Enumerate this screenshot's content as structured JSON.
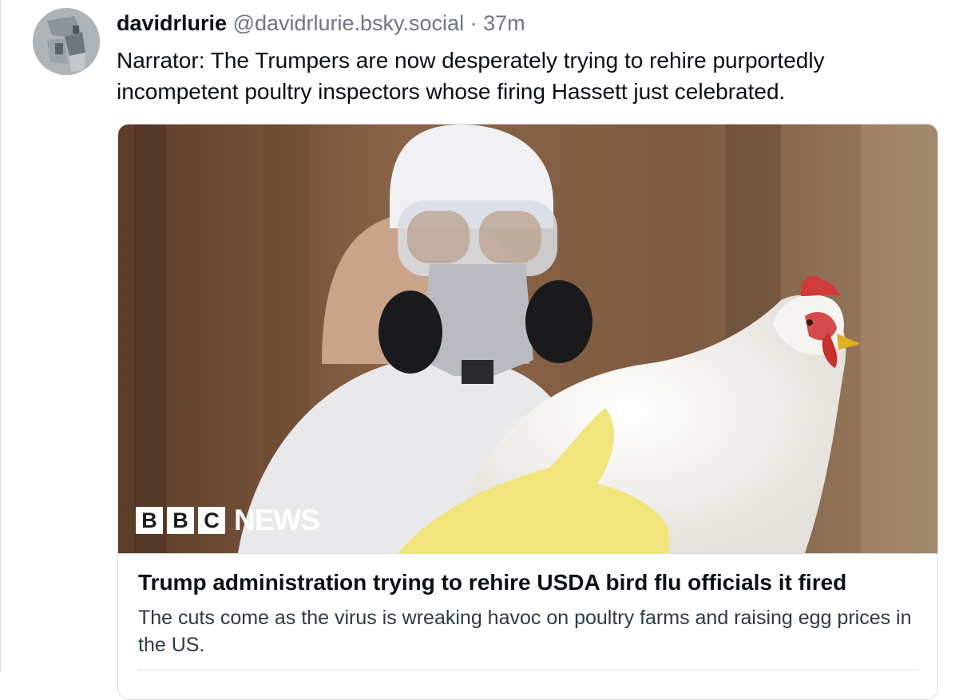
{
  "post": {
    "display_name": "davidrlurie",
    "handle": "@davidrlurie.bsky.social",
    "separator": "·",
    "time": "37m",
    "text": "Narrator: The Trumpers are now desperately trying to rehire purportedly incompetent poultry inspectors whose firing Hassett just celebrated."
  },
  "card": {
    "logo": {
      "letters": [
        "B",
        "B",
        "C"
      ],
      "word": "NEWS"
    },
    "title": "Trump administration trying to rehire USDA bird flu officials it fired",
    "description": "The cuts come as the virus is wreaking havoc on poultry farms and raising egg prices in the US."
  },
  "colors": {
    "text": "#0b0f14",
    "muted": "#6b7884",
    "border": "#d4dbe2"
  }
}
